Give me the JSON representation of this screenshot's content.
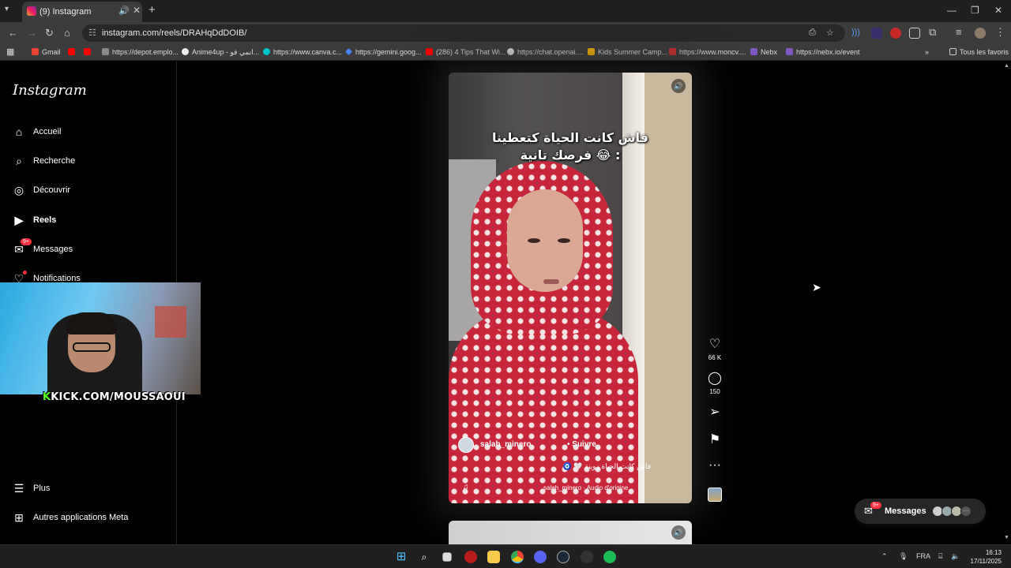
{
  "browser": {
    "tab_title": "(9) Instagram",
    "url": "instagram.com/reels/DRAHqDdDOIB/",
    "bookmarks": [
      {
        "label": "Gmail",
        "color": "#ea4335"
      },
      {
        "label": "",
        "color": "#ff0000"
      },
      {
        "label": "",
        "color": "#ff0000"
      },
      {
        "label": "https://depot.emplo...",
        "color": "#888888"
      },
      {
        "label": "Anime4up - انمي فو...",
        "color": "#eeeeee"
      },
      {
        "label": "https://www.canva.c...",
        "color": "#00c4cc"
      },
      {
        "label": "https://gemini.goog...",
        "color": "#4285f4"
      },
      {
        "label": "(286) 4 Tips That Wi...",
        "color": "#ff0000"
      },
      {
        "label": "https://chat.openai....",
        "color": "#dddddd"
      },
      {
        "label": "Kids Summer Camp...",
        "color": "#f4b400"
      },
      {
        "label": "https://www.moncv....",
        "color": "#d32f2f"
      },
      {
        "label": "Nebx",
        "color": "#7e57c2"
      },
      {
        "label": "https://nebx.io/event",
        "color": "#7e57c2"
      }
    ],
    "all_bookmarks": "Tous les favoris"
  },
  "sidebar": {
    "logo": "Instagram",
    "items": [
      {
        "label": "Accueil",
        "icon": "home-icon",
        "glyph": "⌂"
      },
      {
        "label": "Recherche",
        "icon": "search-icon",
        "glyph": "⌕"
      },
      {
        "label": "Découvrir",
        "icon": "compass-icon",
        "glyph": "◎"
      },
      {
        "label": "Reels",
        "icon": "reels-icon",
        "glyph": "▶"
      },
      {
        "label": "Messages",
        "icon": "messenger-icon",
        "glyph": "✉",
        "badge": "9+"
      },
      {
        "label": "Notifications",
        "icon": "heart-icon",
        "glyph": "♡"
      }
    ],
    "more": "Plus",
    "meta_apps": "Autres applications Meta"
  },
  "stream_overlay": {
    "brand": "K",
    "url_text": "KICK.COM/MOUSSAOUI"
  },
  "reel": {
    "caption": "فاش كانت الحياة كتعطينا\n: 😂 فرصك تانية",
    "username": "salah_minero",
    "follow": "Suivre",
    "description": "فاش كانت الحياة زوينة 🤍 🧿",
    "audio": "salah_minero · Audio d'origine",
    "likes": "66 K",
    "comments": "150"
  },
  "messages_pill": {
    "label": "Messages",
    "badge": "9+"
  },
  "taskbar": {
    "lang": "FRA",
    "time": "16:13",
    "date": "17/11/2025"
  }
}
